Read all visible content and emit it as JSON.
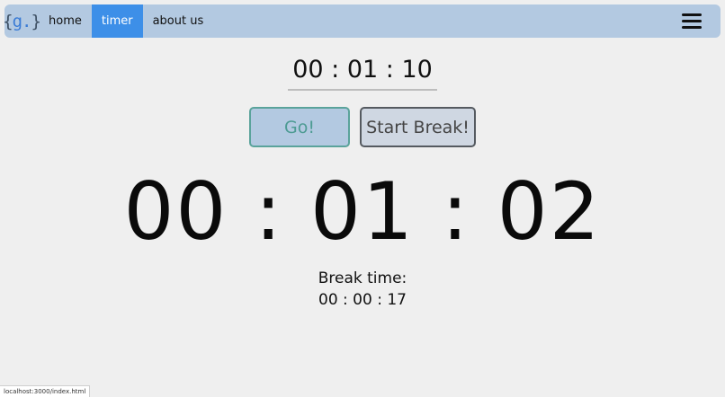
{
  "navbar": {
    "logo": {
      "open": "{",
      "letter": "g.",
      "close": "}"
    },
    "items": [
      {
        "label": "home",
        "active": false
      },
      {
        "label": "timer",
        "active": true
      },
      {
        "label": "about us",
        "active": false
      }
    ],
    "menu_icon": "hamburger-menu-icon"
  },
  "timer_input": {
    "value": "00 :  01 :  10"
  },
  "buttons": {
    "go_label": "Go!",
    "break_label": "Start Break!"
  },
  "main_timer": {
    "value": "00 : 01 : 02"
  },
  "break_section": {
    "label": "Break time:",
    "value": "00 : 00 : 17"
  },
  "status_bar": {
    "url": "localhost:3000/index.html"
  },
  "colors": {
    "navbar_bg": "#b3c9e1",
    "active_tab": "#3d8fe8",
    "go_border": "#5aa39b",
    "page_bg": "#efefef"
  }
}
